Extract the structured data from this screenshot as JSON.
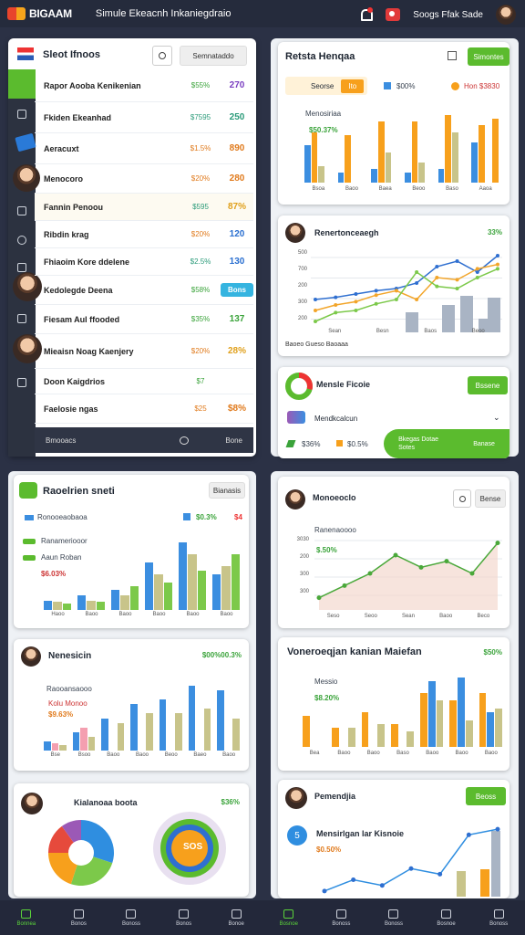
{
  "topbar": {
    "brand": "BIGAAM",
    "subtitle": "Simule Ekeacnh Inkaniegdraio",
    "user_label": "Soogs Ffak Sade"
  },
  "list_panel": {
    "title": "Sleot Ifnoos",
    "action": "Semnataddo",
    "rows": [
      {
        "name": "Rapor Aooba Kenikenian",
        "pct": "$55%",
        "val": "270",
        "pct_color": "#3aa33a",
        "val_color": "#7b3fc1"
      },
      {
        "name": "Fkiden Ekeanhad",
        "pct": "$7595",
        "val": "250",
        "pct_color": "#2c9b7a",
        "val_color": "#2c9b7a"
      },
      {
        "name": "Aeracuxt",
        "pct": "$1.5%",
        "val": "890",
        "pct_color": "#e07a1c",
        "val_color": "#e07a1c"
      },
      {
        "name": "Menocoro",
        "pct": "$20%",
        "val": "280",
        "pct_color": "#e07a1c",
        "val_color": "#e07a1c"
      },
      {
        "name": "Fannin Penoou",
        "pct": "$595",
        "val": "87%",
        "pct_color": "#2c9b7a",
        "val_color": "#e0a01c"
      },
      {
        "name": "Ribdin krag",
        "pct": "$20%",
        "val": "120",
        "pct_color": "#e07a1c",
        "val_color": "#2a6fd0"
      },
      {
        "name": "Fhiaoim Kore ddelene",
        "pct": "$2.5%",
        "val": "130",
        "pct_color": "#2c9b7a",
        "val_color": "#2a6fd0"
      },
      {
        "name": "Kedolegde Deena",
        "pct": "$58%",
        "val": "Bons",
        "pct_color": "#3aa33a",
        "val_color": "#ffffff"
      },
      {
        "name": "Fiesam Aul ffooded",
        "pct": "$35%",
        "val": "137",
        "pct_color": "#3aa33a",
        "val_color": "#3aa33a"
      },
      {
        "name": "Mieaisn Noag Kaenjery",
        "pct": "$20%",
        "val": "28%",
        "pct_color": "#e07a1c",
        "val_color": "#e0a01c"
      },
      {
        "name": "Doon Kaigdrios",
        "pct": "$7",
        "val": "",
        "pct_color": "#3aa33a",
        "val_color": "#e07a1c"
      },
      {
        "name": "Faelosie ngas",
        "pct": "$25",
        "val": "$8%",
        "pct_color": "#e07a1c",
        "val_color": "#e07a1c"
      }
    ],
    "footer_left": "Bmooacs",
    "footer_right": "Bone"
  },
  "revenue_card": {
    "title": "Retsta Henqaa",
    "action": "Simontes",
    "tag1": "Seorse",
    "tag2": "Ito",
    "legend1": "$00%",
    "legend2": "Hon $3830",
    "series_label": "Menosiriaa",
    "value": "$50.37%",
    "chart_data": {
      "type": "bar",
      "categories": [
        "Bsoa",
        "Baoo",
        "Baea",
        "Beoo",
        "Baso",
        "Aaoa"
      ],
      "series": [
        {
          "color": "#3b8ee0",
          "values": [
            55,
            15,
            20,
            15,
            20,
            60
          ]
        },
        {
          "color": "#f7a01c",
          "values": [
            75,
            70,
            90,
            90,
            100,
            85
          ]
        },
        {
          "color": "#c8c48a",
          "values": [
            25,
            0,
            45,
            30,
            75,
            0
          ]
        },
        {
          "color": "#f7a01c",
          "values": [
            0,
            0,
            0,
            0,
            0,
            95
          ]
        }
      ]
    }
  },
  "line_card": {
    "title": "Renertonceaegh",
    "pct": "33%",
    "y_ticks": [
      "500",
      "700",
      "200",
      "300",
      "200"
    ],
    "x_ticks": [
      "Sean",
      "Besn",
      "Baos",
      "Beoo"
    ],
    "footer": "Baoeo Gueso    Baoaaa",
    "chart_data": {
      "type": "line",
      "x": [
        0,
        1,
        2,
        3,
        4,
        5,
        6,
        7,
        8,
        9
      ],
      "series": [
        {
          "color": "#2f6fd0",
          "values": [
            30,
            32,
            35,
            38,
            40,
            45,
            60,
            65,
            55,
            70
          ]
        },
        {
          "color": "#f2a52a",
          "values": [
            20,
            25,
            28,
            34,
            38,
            30,
            50,
            48,
            58,
            62
          ]
        },
        {
          "color": "#7cc94a",
          "values": [
            10,
            18,
            20,
            26,
            30,
            55,
            42,
            40,
            50,
            58
          ]
        }
      ]
    }
  },
  "donut_card": {
    "title": "Mensle Ficoie",
    "action": "Bssene",
    "row2": "Mendkcalcun",
    "s1": "$36%",
    "s2": "$0.5%",
    "btn_left": "Bkegas Dotae Sotes",
    "btn_right": "Banase"
  },
  "bar_card2": {
    "title": "Raoelrien sneti",
    "btn": "Bianasis",
    "legend1": "Ronooeaobaoa",
    "legend2": "$0.3%",
    "legend2_sub": "$4",
    "label1": "Ranameriooor",
    "label2": "Aaun Roban",
    "pct": "$6.03%",
    "chart_data": {
      "type": "bar",
      "categories": [
        "Haoo",
        "Baoo",
        "Baoo",
        "Baoo",
        "Baoo",
        "Baoo"
      ],
      "series": [
        {
          "color": "#3b8ee0",
          "values": [
            12,
            18,
            25,
            60,
            85,
            45
          ]
        },
        {
          "color": "#c8c48a",
          "values": [
            10,
            12,
            18,
            45,
            70,
            55
          ]
        },
        {
          "color": "#7cc94a",
          "values": [
            8,
            10,
            30,
            35,
            50,
            70
          ]
        }
      ]
    }
  },
  "area_card": {
    "title": "Monoeoclo",
    "action": "Bense",
    "label": "Ranenaoooo",
    "pct": "$.50%",
    "y_ticks": [
      "3030",
      "200",
      "300",
      "300"
    ],
    "x_ticks": [
      "Seso",
      "Seoo",
      "Sean",
      "Baoo",
      "Beco"
    ],
    "chart_data": {
      "type": "area",
      "x": [
        0,
        1,
        2,
        3,
        4,
        5,
        6,
        7
      ],
      "values": [
        10,
        20,
        30,
        45,
        35,
        40,
        30,
        55
      ]
    }
  },
  "bar_card3": {
    "title": "Nenesicin",
    "pct": "$00%00.3%",
    "label": "Raooansaooo",
    "l2": "Kolu Monoo",
    "pct2": "$9.63%",
    "chart_data": {
      "type": "bar",
      "categories": [
        "Bse",
        "Bsoo",
        "Baoo",
        "Baoo",
        "Beoo",
        "Baeo",
        "Baoo"
      ],
      "series": [
        {
          "color": "#3b8ee0",
          "values": [
            10,
            20,
            35,
            50,
            55,
            70,
            65
          ]
        },
        {
          "color": "#f49fb0",
          "values": [
            8,
            25,
            0,
            0,
            0,
            0,
            0
          ]
        },
        {
          "color": "#c8c48a",
          "values": [
            6,
            15,
            30,
            40,
            40,
            45,
            35
          ]
        }
      ]
    }
  },
  "bar_card4": {
    "title": "Voneroeqjan kanian Maiefan",
    "pct": "$50%",
    "label": "Messio",
    "pct2": "$8.20%",
    "chart_data": {
      "type": "bar",
      "categories": [
        "Bea",
        "Baoo",
        "Baoo",
        "Baso",
        "Baoo",
        "Baoo",
        "Baoo"
      ],
      "series": [
        {
          "color": "#f7a01c",
          "values": [
            40,
            25,
            45,
            30,
            70,
            60,
            70
          ]
        },
        {
          "color": "#3b8ee0",
          "values": [
            0,
            0,
            0,
            0,
            85,
            90,
            45
          ]
        },
        {
          "color": "#c8c48a",
          "values": [
            0,
            25,
            30,
            20,
            60,
            35,
            50
          ]
        }
      ]
    }
  },
  "pie_card": {
    "title": "Kialanoaa boota",
    "pct": "$36%",
    "center": "SOS",
    "chart_data": {
      "type": "pie",
      "values": [
        30,
        25,
        20,
        15,
        10
      ],
      "colors": [
        "#2f8ee0",
        "#7cc94a",
        "#f7a01c",
        "#e64a3c",
        "#9b59b6"
      ]
    }
  },
  "last_card": {
    "title": "Pemendjia",
    "btn": "Beoss",
    "label": "Mensirlgan lar Kisnoie",
    "pct": "$0.50%",
    "chart_data": {
      "type": "line",
      "x": [
        0,
        1,
        2,
        3,
        4,
        5,
        6
      ],
      "values": [
        5,
        15,
        10,
        25,
        20,
        55,
        60
      ]
    }
  },
  "bottom_nav": [
    "Bonnea",
    "Bonos",
    "Bonoss",
    "Bonos",
    "Bonoe",
    "Bosnoe",
    "Bonoss",
    "Bonoss",
    "Bosnoe",
    "Bonoss"
  ]
}
